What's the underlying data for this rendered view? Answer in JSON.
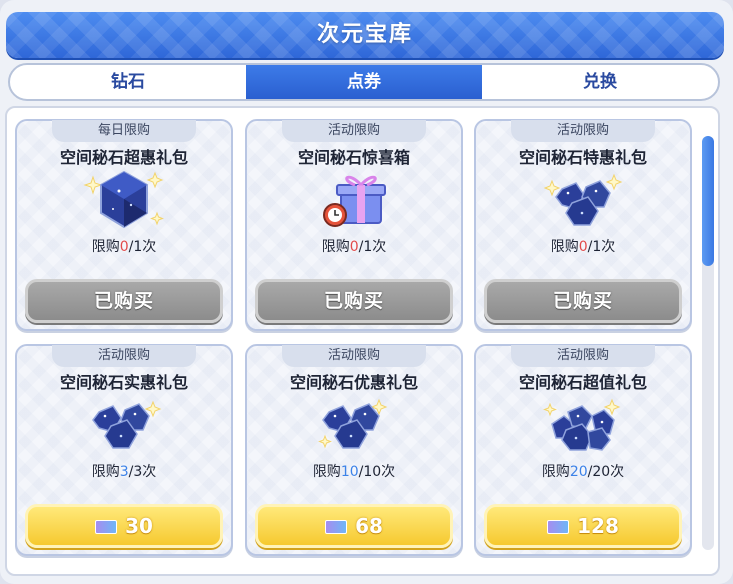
{
  "header": {
    "title": "次元宝库"
  },
  "tabs": [
    {
      "label": "钻石",
      "active": false
    },
    {
      "label": "点券",
      "active": true
    },
    {
      "label": "兑换",
      "active": false
    }
  ],
  "colors": {
    "accent": "#2f67d8",
    "limit_red": "#e14b4b",
    "limit_blue": "#3c82e8",
    "buy_button": "#f6c92f"
  },
  "items": [
    {
      "tag": "每日限购",
      "name": "空间秘石超惠礼包",
      "icon": "single-gem-icon",
      "limit_label": "限购",
      "limit_used": "0",
      "limit_total": "/1次",
      "button": "已购买",
      "state": "purchased"
    },
    {
      "tag": "活动限购",
      "name": "空间秘石惊喜箱",
      "icon": "gift-box-icon",
      "limit_label": "限购",
      "limit_used": "0",
      "limit_total": "/1次",
      "button": "已购买",
      "state": "purchased"
    },
    {
      "tag": "活动限购",
      "name": "空间秘石特惠礼包",
      "icon": "gem-cluster-icon",
      "limit_label": "限购",
      "limit_used": "0",
      "limit_total": "/1次",
      "button": "已购买",
      "state": "purchased"
    },
    {
      "tag": "活动限购",
      "name": "空间秘石实惠礼包",
      "icon": "gem-cluster-icon",
      "limit_label": "限购",
      "limit_used": "3",
      "limit_total": "/3次",
      "price": "30",
      "state": "available"
    },
    {
      "tag": "活动限购",
      "name": "空间秘石优惠礼包",
      "icon": "gem-cluster-icon",
      "limit_label": "限购",
      "limit_used": "10",
      "limit_total": "/10次",
      "price": "68",
      "state": "available"
    },
    {
      "tag": "活动限购",
      "name": "空间秘石超值礼包",
      "icon": "gem-pile-icon",
      "limit_label": "限购",
      "limit_used": "20",
      "limit_total": "/20次",
      "price": "128",
      "state": "available"
    }
  ]
}
